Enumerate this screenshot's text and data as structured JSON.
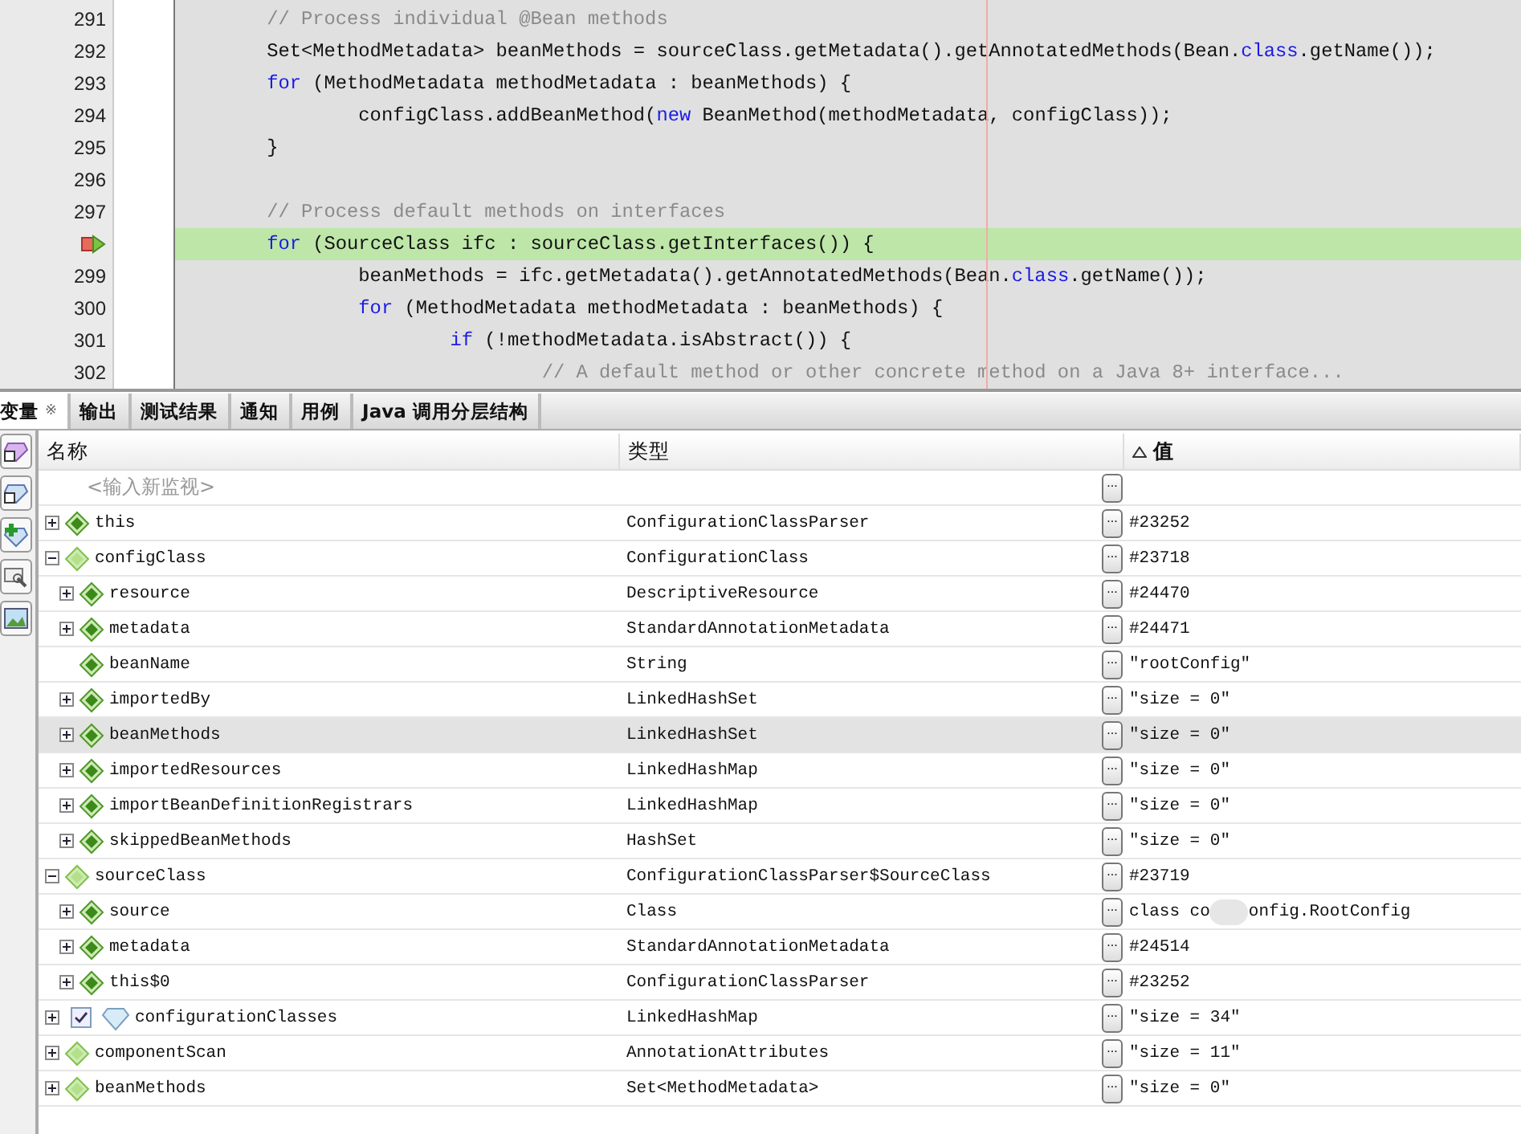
{
  "editor": {
    "lines": [
      {
        "number": "291",
        "current": false,
        "segments": [
          {
            "kind": "comment",
            "text": "        // Process individual @Bean methods"
          }
        ]
      },
      {
        "number": "292",
        "current": false,
        "segments": [
          {
            "kind": "plain",
            "text": "        Set<MethodMetadata> beanMethods = sourceClass.getMetadata().getAnnotatedMethods(Bean."
          },
          {
            "kind": "keyword",
            "text": "class"
          },
          {
            "kind": "plain",
            "text": ".getName());"
          }
        ]
      },
      {
        "number": "293",
        "current": false,
        "segments": [
          {
            "kind": "keyword",
            "text": "        for"
          },
          {
            "kind": "plain",
            "text": " (MethodMetadata methodMetadata : beanMethods) {"
          }
        ]
      },
      {
        "number": "294",
        "current": false,
        "segments": [
          {
            "kind": "plain",
            "text": "                configClass.addBeanMethod("
          },
          {
            "kind": "keyword",
            "text": "new"
          },
          {
            "kind": "plain",
            "text": " BeanMethod(methodMetadata, configClass));"
          }
        ]
      },
      {
        "number": "295",
        "current": false,
        "segments": [
          {
            "kind": "plain",
            "text": "        }"
          }
        ]
      },
      {
        "number": "296",
        "current": false
      },
      {
        "number": "297",
        "current": false,
        "segments": [
          {
            "kind": "comment",
            "text": "        // Process default methods on interfaces"
          }
        ]
      },
      {
        "current": true,
        "segments": [
          {
            "kind": "keyword",
            "text": "        for"
          },
          {
            "kind": "plain",
            "text": " (SourceClass ifc : sourceClass.getInterfaces()) {"
          }
        ]
      },
      {
        "number": "299",
        "current": false,
        "segments": [
          {
            "kind": "plain",
            "text": "                beanMethods = ifc.getMetadata().getAnnotatedMethods(Bean."
          },
          {
            "kind": "keyword",
            "text": "class"
          },
          {
            "kind": "plain",
            "text": ".getName());"
          }
        ]
      },
      {
        "number": "300",
        "current": false,
        "segments": [
          {
            "kind": "keyword",
            "text": "                for"
          },
          {
            "kind": "plain",
            "text": " (MethodMetadata methodMetadata : beanMethods) {"
          }
        ]
      },
      {
        "number": "301",
        "current": false,
        "segments": [
          {
            "kind": "keyword",
            "text": "                        if"
          },
          {
            "kind": "plain",
            "text": " (!methodMetadata.isAbstract()) {"
          }
        ]
      },
      {
        "number": "302",
        "current": false,
        "segments": [
          {
            "kind": "comment",
            "text": "                                // A default method or other concrete method on a Java 8+ interface..."
          }
        ]
      }
    ]
  },
  "tabs": [
    {
      "label": "变量",
      "selected": true,
      "close": "※"
    },
    {
      "label": "输出",
      "selected": false
    },
    {
      "label": "测试结果",
      "selected": false
    },
    {
      "label": "通知",
      "selected": false
    },
    {
      "label": "用例",
      "selected": false
    },
    {
      "label": "Java 调用分层结构",
      "selected": false
    }
  ],
  "table": {
    "columns": [
      {
        "label": "名称",
        "sorted": false
      },
      {
        "label": "类型",
        "sorted": false
      },
      {
        "label": "值",
        "sorted": true
      }
    ],
    "new_watch": {
      "placeholder": "<输入新监视>",
      "button": "..."
    },
    "rows": [
      {
        "name": "this",
        "kind": "field",
        "expanded": false,
        "selected": false,
        "type": "ConfigurationClassParser",
        "button": "...",
        "value": "#23252"
      },
      {
        "name": "configClass",
        "kind": "variable",
        "expanded": true,
        "selected": false,
        "type": "ConfigurationClass",
        "button": "...",
        "value": "#23718",
        "children": [
          {
            "name": "resource",
            "kind": "field",
            "expanded": false,
            "selected": false,
            "type": "DescriptiveResource",
            "button": "...",
            "value": "#24470"
          },
          {
            "name": "metadata",
            "kind": "field",
            "expanded": false,
            "selected": false,
            "type": "StandardAnnotationMetadata",
            "button": "...",
            "value": "#24471"
          },
          {
            "name": "beanName",
            "kind": "field",
            "selected": false,
            "type": "String",
            "button": "...",
            "value": "\"rootConfig\""
          },
          {
            "name": "importedBy",
            "kind": "field",
            "expanded": false,
            "selected": false,
            "type": "LinkedHashSet",
            "button": "...",
            "value": "\"size = 0\""
          },
          {
            "name": "beanMethods",
            "kind": "field",
            "expanded": false,
            "selected": true,
            "type": "LinkedHashSet",
            "button": "...",
            "value": "\"size = 0\""
          },
          {
            "name": "importedResources",
            "kind": "field",
            "expanded": false,
            "selected": false,
            "type": "LinkedHashMap",
            "button": "...",
            "value": "\"size = 0\""
          },
          {
            "name": "importBeanDefinitionRegistrars",
            "kind": "field",
            "expanded": false,
            "selected": false,
            "type": "LinkedHashMap",
            "button": "...",
            "value": "\"size = 0\""
          },
          {
            "name": "skippedBeanMethods",
            "kind": "field",
            "expanded": false,
            "selected": false,
            "type": "HashSet",
            "button": "...",
            "value": "\"size = 0\""
          }
        ]
      },
      {
        "name": "sourceClass",
        "kind": "variable",
        "expanded": true,
        "selected": false,
        "type": "ConfigurationClassParser$SourceClass",
        "button": "...",
        "value": "#23719",
        "children": [
          {
            "name": "source",
            "kind": "field",
            "expanded": false,
            "selected": false,
            "type": "Class",
            "button": "...",
            "value": "class co",
            "value_after_blur": "onfig.RootConfig"
          },
          {
            "name": "metadata",
            "kind": "field",
            "expanded": false,
            "selected": false,
            "type": "StandardAnnotationMetadata",
            "button": "...",
            "value": "#24514"
          },
          {
            "name": "this$0",
            "kind": "field",
            "expanded": false,
            "selected": false,
            "type": "ConfigurationClassParser",
            "button": "...",
            "value": "#23252"
          }
        ]
      },
      {
        "name": "configurationClasses",
        "kind": "watch",
        "checked": true,
        "expanded": false,
        "selected": false,
        "type": "LinkedHashMap",
        "button": "...",
        "value": "\"size = 34\""
      },
      {
        "name": "componentScan",
        "kind": "variable",
        "expanded": false,
        "selected": false,
        "type": "AnnotationAttributes",
        "button": "...",
        "value": "\"size = 11\""
      },
      {
        "name": "beanMethods",
        "kind": "variable",
        "expanded": false,
        "selected": false,
        "type": "Set<MethodMetadata>",
        "button": "...",
        "value": "\"size = 0\""
      }
    ]
  }
}
